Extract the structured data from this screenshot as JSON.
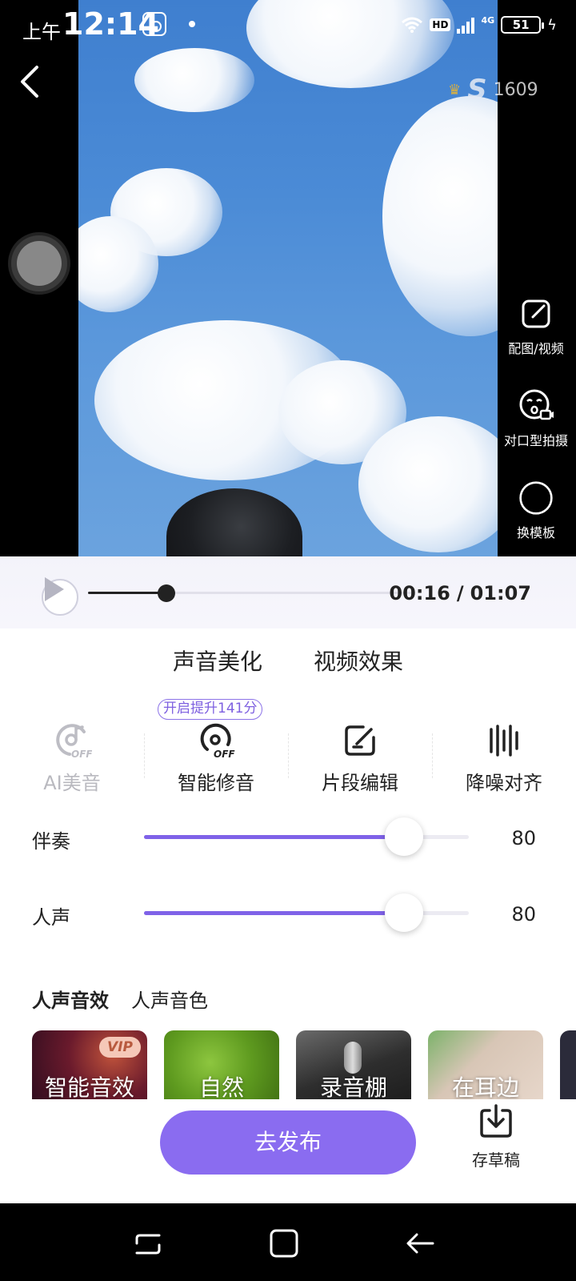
{
  "status_bar": {
    "ampm": "上午",
    "time": "12:14",
    "hd": "HD",
    "network": "4G",
    "battery": "51"
  },
  "video": {
    "score": "1609",
    "score_letter": "S",
    "side_tools": [
      {
        "label": "配图/视频",
        "icon": "edit-icon"
      },
      {
        "label": "对口型拍摄",
        "icon": "face-camera-icon"
      },
      {
        "label": "换模板",
        "icon": "circle-icon"
      }
    ]
  },
  "player": {
    "current": "00:16",
    "separator": "/",
    "total": "01:07",
    "progress": 0.24
  },
  "main_tabs": [
    {
      "label": "声音美化",
      "active": true
    },
    {
      "label": "视频效果",
      "active": false
    }
  ],
  "hint": "开启提升141分",
  "tools": [
    {
      "label": "AI美音",
      "icon": "ai-off-icon",
      "disabled": true
    },
    {
      "label": "智能修音",
      "icon": "smart-tune-off-icon",
      "disabled": false
    },
    {
      "label": "片段编辑",
      "icon": "edit-icon",
      "disabled": false
    },
    {
      "label": "降噪对齐",
      "icon": "noise-bars-icon",
      "disabled": false
    }
  ],
  "off_text": "OFF",
  "sliders": [
    {
      "label": "伴奏",
      "value": "80",
      "level": 0.8
    },
    {
      "label": "人声",
      "value": "80",
      "level": 0.8
    }
  ],
  "sub_tabs": [
    {
      "label": "人声音效",
      "active": true
    },
    {
      "label": "人声音色",
      "active": false
    }
  ],
  "effects": [
    {
      "name": "智能音效",
      "vip": "VIP"
    },
    {
      "name": "自然",
      "vip": ""
    },
    {
      "name": "录音棚",
      "vip": ""
    },
    {
      "name": "在耳边",
      "vip": ""
    }
  ],
  "actions": {
    "publish": "去发布",
    "draft": "存草稿"
  },
  "colors": {
    "accent": "#8a6cf0",
    "highlight": "#fde64b"
  }
}
